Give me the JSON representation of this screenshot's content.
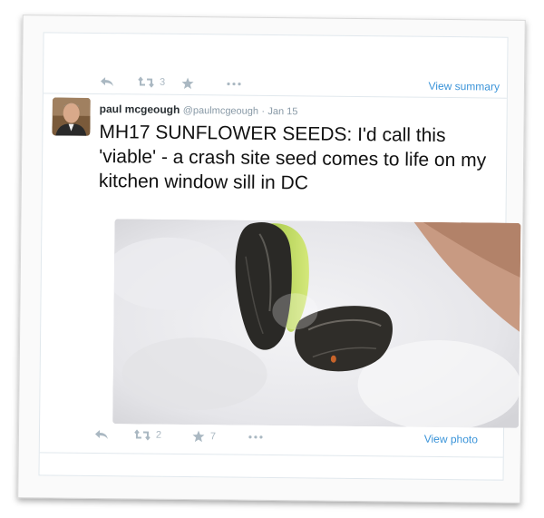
{
  "top_actions": {
    "retweet_count": "3",
    "link_label": "View summary"
  },
  "tweet": {
    "author_name": "paul mcgeough",
    "author_handle": "@paulmcgeough",
    "separator": "·",
    "date": "Jan 15",
    "text": "MH17 SUNFLOWER SEEDS: I'd call this 'viable' - a crash site seed comes to life on my kitchen window sill in DC"
  },
  "bottom_actions": {
    "retweet_count": "2",
    "favorite_count": "7",
    "link_label": "View photo"
  },
  "colors": {
    "link": "#3b94d9",
    "action_icon": "#aab8c2",
    "border": "#e1e8ed"
  }
}
